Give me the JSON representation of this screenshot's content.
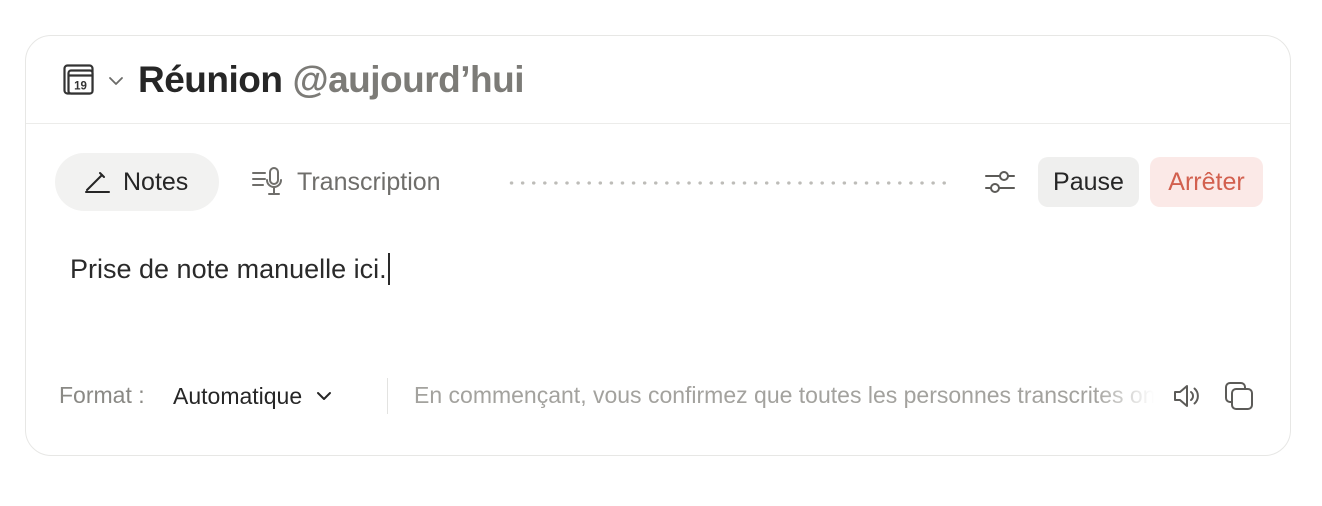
{
  "header": {
    "calendar_icon_day": "19",
    "title": "Réunion",
    "date_mention": "@aujourd’hui"
  },
  "tabs": [
    {
      "label": "Notes",
      "active": true,
      "icon": "pen-icon"
    },
    {
      "label": "Transcription",
      "active": false,
      "icon": "transcript-mic-icon"
    }
  ],
  "controls": {
    "settings_icon": "sliders-icon",
    "pause_label": "Pause",
    "stop_label": "Arrêter"
  },
  "editor": {
    "text": "Prise de note manuelle ici."
  },
  "footer": {
    "format_label": "Format :",
    "format_value": "Automatique",
    "consent_text": "En commençant, vous confirmez que toutes les personnes transcrites ont donné leur consentement.",
    "speaker_icon": "speaker-icon",
    "copy_icon": "copy-icon"
  },
  "colors": {
    "stop_text": "#d2604f",
    "stop_bg": "#fbe9e7",
    "muted_text": "#7c7b77",
    "active_tab_bg": "#f2f2f1"
  }
}
